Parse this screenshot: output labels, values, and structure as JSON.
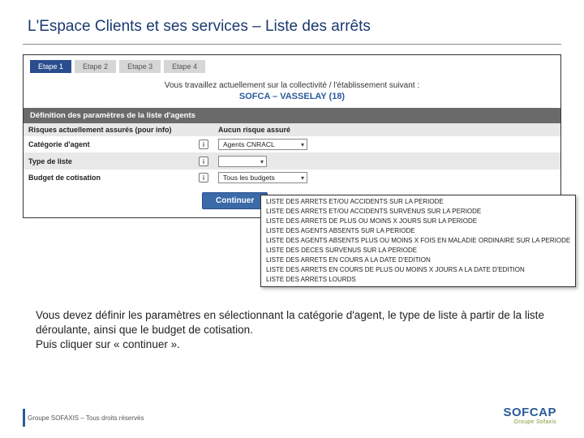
{
  "title": "L'Espace Clients et ses services – Liste des arrêts",
  "steps": [
    "Etape 1",
    "Etape 2",
    "Etape 3",
    "Etape 4"
  ],
  "working_on_label": "Vous travaillez actuellement sur la collectivité / l'établissement suivant :",
  "entity": "SOFCA – VASSELAY (18)",
  "params_header": "Définition des paramètres de la liste d'agents",
  "rows": {
    "risks_label": "Risques actuellement assurés (pour info)",
    "risks_value": "Aucun risque assuré",
    "cat_label": "Catégorie d'agent",
    "cat_value": "Agents CNRACL",
    "type_label": "Type de liste",
    "type_value": "",
    "budget_label": "Budget de cotisation",
    "budget_value": "Tous les budgets"
  },
  "continue_label": "Continuer",
  "dropdown": [
    "LISTE DES ARRETS ET/OU ACCIDENTS SUR LA PERIODE",
    "LISTE DES ARRETS ET/OU ACCIDENTS SURVENUS SUR LA PERIODE",
    "LISTE DES ARRETS DE PLUS OU MOINS X JOURS SUR LA PERIODE",
    "LISTE DES AGENTS ABSENTS SUR LA PERIODE",
    "LISTE DES AGENTS ABSENTS PLUS OU MOINS X FOIS EN MALADIE ORDINAIRE SUR LA PERIODE",
    "LISTE DES DECES SURVENUS SUR LA PERIODE",
    "LISTE DES ARRETS EN COURS A LA DATE D'EDITION",
    "LISTE DES ARRETS EN COURS DE PLUS OU MOINS X JOURS A LA DATE D'EDITION",
    "LISTE DES ARRETS LOURDS"
  ],
  "caption_line1": "Vous devez définir les paramètres en sélectionnant la catégorie d'agent, le type de liste à partir de la liste déroulante, ainsi que le budget de cotisation.",
  "caption_line2": "Puis cliquer sur « continuer ».",
  "footer": "Groupe SOFAXIS – Tous droits réservés",
  "logo_main": "SOFCAP",
  "logo_sub": "Groupe Sofaxis"
}
